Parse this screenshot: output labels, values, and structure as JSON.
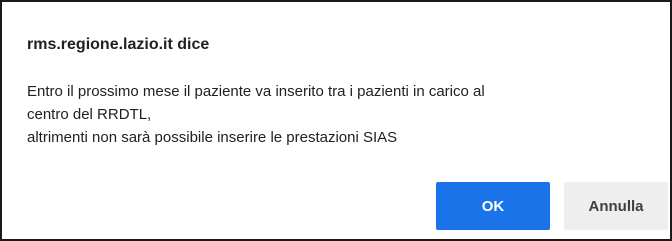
{
  "dialog": {
    "title": "rms.regione.lazio.it dice",
    "message_lines": [
      "Entro il prossimo mese il paziente va inserito tra i pazienti in carico al",
      "centro del RRDTL,",
      "altrimenti non sarà possibile inserire le prestazioni SIAS"
    ],
    "buttons": {
      "ok_label": "OK",
      "cancel_label": "Annulla"
    }
  },
  "colors": {
    "primary_button": "#1a73e8",
    "secondary_button": "#eeeeee",
    "border": "#1a1a1a"
  }
}
